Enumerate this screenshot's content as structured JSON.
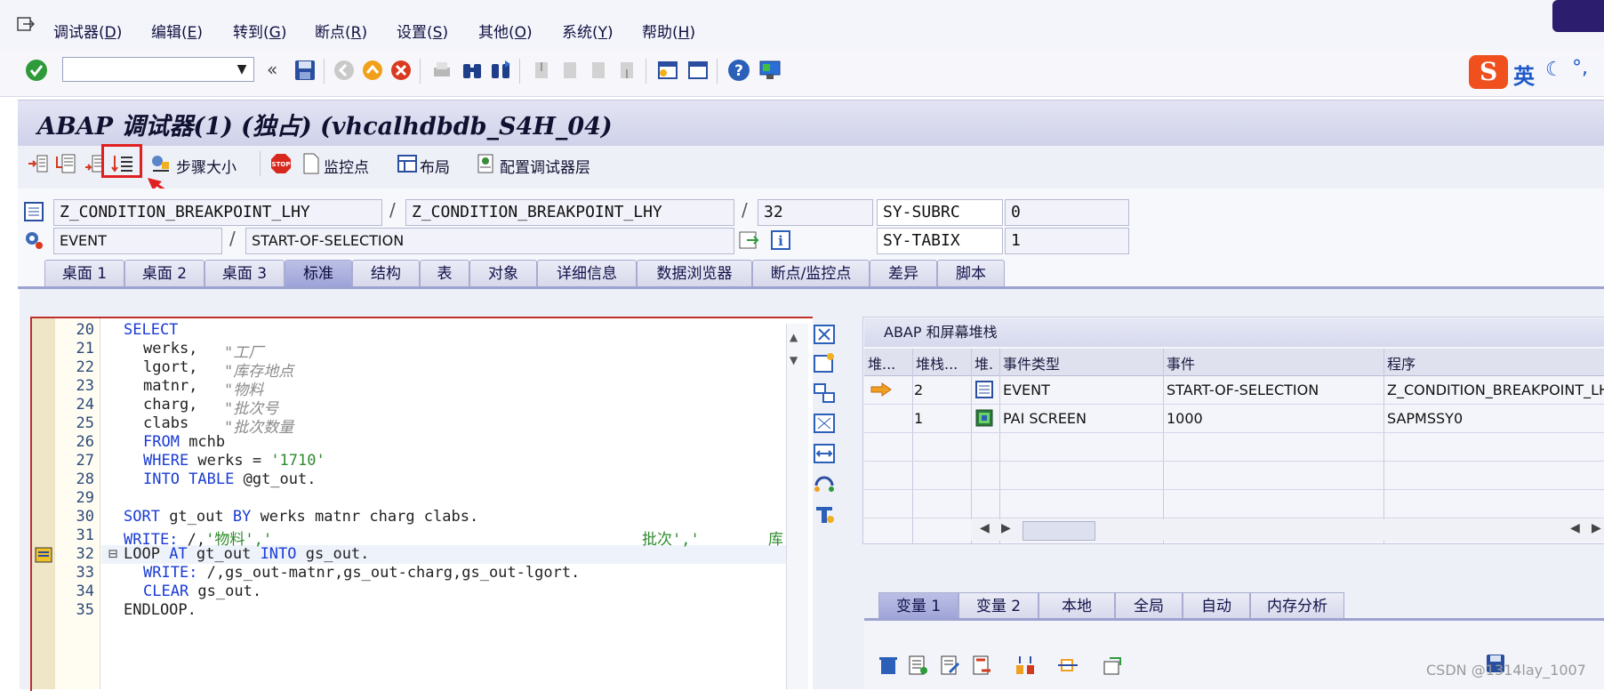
{
  "menu": [
    {
      "label": "调试器",
      "key": "D"
    },
    {
      "label": "编辑",
      "key": "E"
    },
    {
      "label": "转到",
      "key": "G"
    },
    {
      "label": "断点",
      "key": "R"
    },
    {
      "label": "设置",
      "key": "S"
    },
    {
      "label": "其他",
      "key": "O"
    },
    {
      "label": "系统",
      "key": "Y"
    },
    {
      "label": "帮助",
      "key": "H"
    }
  ],
  "ime": {
    "logo": "S",
    "lang": "英"
  },
  "title": "ABAP 调试器(1) (独占) (vhcalhdbdb_S4H_04)",
  "app_toolbar": {
    "step_size": "步骤大小",
    "watchpoint": "监控点",
    "layout": "布局",
    "config_layers": "配置调试器层"
  },
  "fields": {
    "program": "Z_CONDITION_BREAKPOINT_LHY",
    "include": "Z_CONDITION_BREAKPOINT_LHY",
    "line": "32",
    "subrc_label": "SY-SUBRC",
    "subrc_value": "0",
    "event_type": "EVENT",
    "event_name": "START-OF-SELECTION",
    "tabix_label": "SY-TABIX",
    "tabix_value": "1",
    "slash": "/"
  },
  "tabs": [
    "桌面 1",
    "桌面 2",
    "桌面 3",
    "标准",
    "结构",
    "表",
    "对象",
    "详细信息",
    "数据浏览器",
    "断点/监控点",
    "差异",
    "脚本"
  ],
  "active_tab": "标准",
  "code": {
    "line_numbers": [
      "20",
      "21",
      "22",
      "23",
      "24",
      "25",
      "26",
      "27",
      "28",
      "29",
      "30",
      "31",
      "32",
      "33",
      "34",
      "35"
    ],
    "lines": {
      "l20": "SELECT",
      "l21a": "werks,",
      "l21c": "\"工厂",
      "l22a": "lgort,",
      "l22c": "\"库存地点",
      "l23a": "matnr,",
      "l23c": "\"物料",
      "l24a": "charg,",
      "l24c": "\"批次号",
      "l25a": "clabs",
      "l25c": "\"批次数量",
      "l26k": "FROM",
      "l26r": " mchb",
      "l27k": "WHERE",
      "l27r": " werks = ",
      "l27s": "'1710'",
      "l28k": "INTO TABLE",
      "l28r": " @gt_out.",
      "l30k1": "SORT",
      "l30r1": " gt_out ",
      "l30k2": "BY",
      "l30r2": " werks matnr charg clabs.",
      "l31k": "WRITE:",
      "l31r": " /,",
      "l31s": "'物料','",
      "l31s2": "批次','",
      "l31s3": "库",
      "l32k1": "LOOP",
      "l32k2": " AT",
      "l32r": " gt_out ",
      "l32k3": "INTO",
      "l32r2": " gs_out.",
      "l33k": "WRITE:",
      "l33r": " /,gs_out-matnr,gs_out-charg,gs_out-lgort.",
      "l34k": "CLEAR",
      "l34r": " gs_out.",
      "l35": "ENDLOOP."
    },
    "fold_marker": "⊟"
  },
  "stack": {
    "header": "ABAP 和屏幕堆栈",
    "columns": [
      "堆...",
      "堆栈...",
      "堆.",
      "事件类型",
      "事件",
      "程序"
    ],
    "rows": [
      {
        "level": "2",
        "type": "EVENT",
        "event": "START-OF-SELECTION",
        "program": "Z_CONDITION_BREAKPOINT_LHY"
      },
      {
        "level": "1",
        "type": "PAI SCREEN",
        "event": "1000",
        "program": "SAPMSSY0"
      }
    ]
  },
  "var_tabs": [
    "变量 1",
    "变量 2",
    "本地",
    "全局",
    "自动",
    "内存分析"
  ],
  "watermark": "CSDN @1314lay_1007"
}
